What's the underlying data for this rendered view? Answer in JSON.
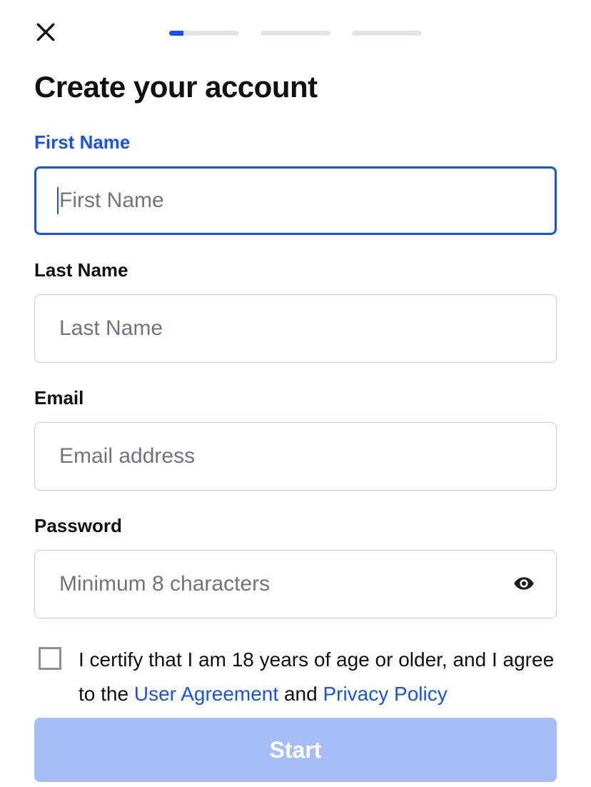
{
  "progress": {
    "steps": 3,
    "current": 1,
    "currentFill": 0.2,
    "activeColor": "#1552f0",
    "trackColor": "#e2e5ea"
  },
  "title": "Create your account",
  "fields": {
    "firstName": {
      "label": "First Name",
      "placeholder": "First Name",
      "value": "",
      "focused": true
    },
    "lastName": {
      "label": "Last Name",
      "placeholder": "Last Name",
      "value": "",
      "focused": false
    },
    "email": {
      "label": "Email",
      "placeholder": "Email address",
      "value": "",
      "focused": false
    },
    "password": {
      "label": "Password",
      "placeholder": "Minimum 8 characters",
      "value": "",
      "focused": false
    }
  },
  "certify": {
    "checked": false,
    "text_pre": "I certify that I am 18 years of age or older, and I agree to the ",
    "link1": "User Agreement",
    "text_mid": " and ",
    "link2": "Privacy Policy"
  },
  "startButton": {
    "label": "Start",
    "enabled": false
  }
}
